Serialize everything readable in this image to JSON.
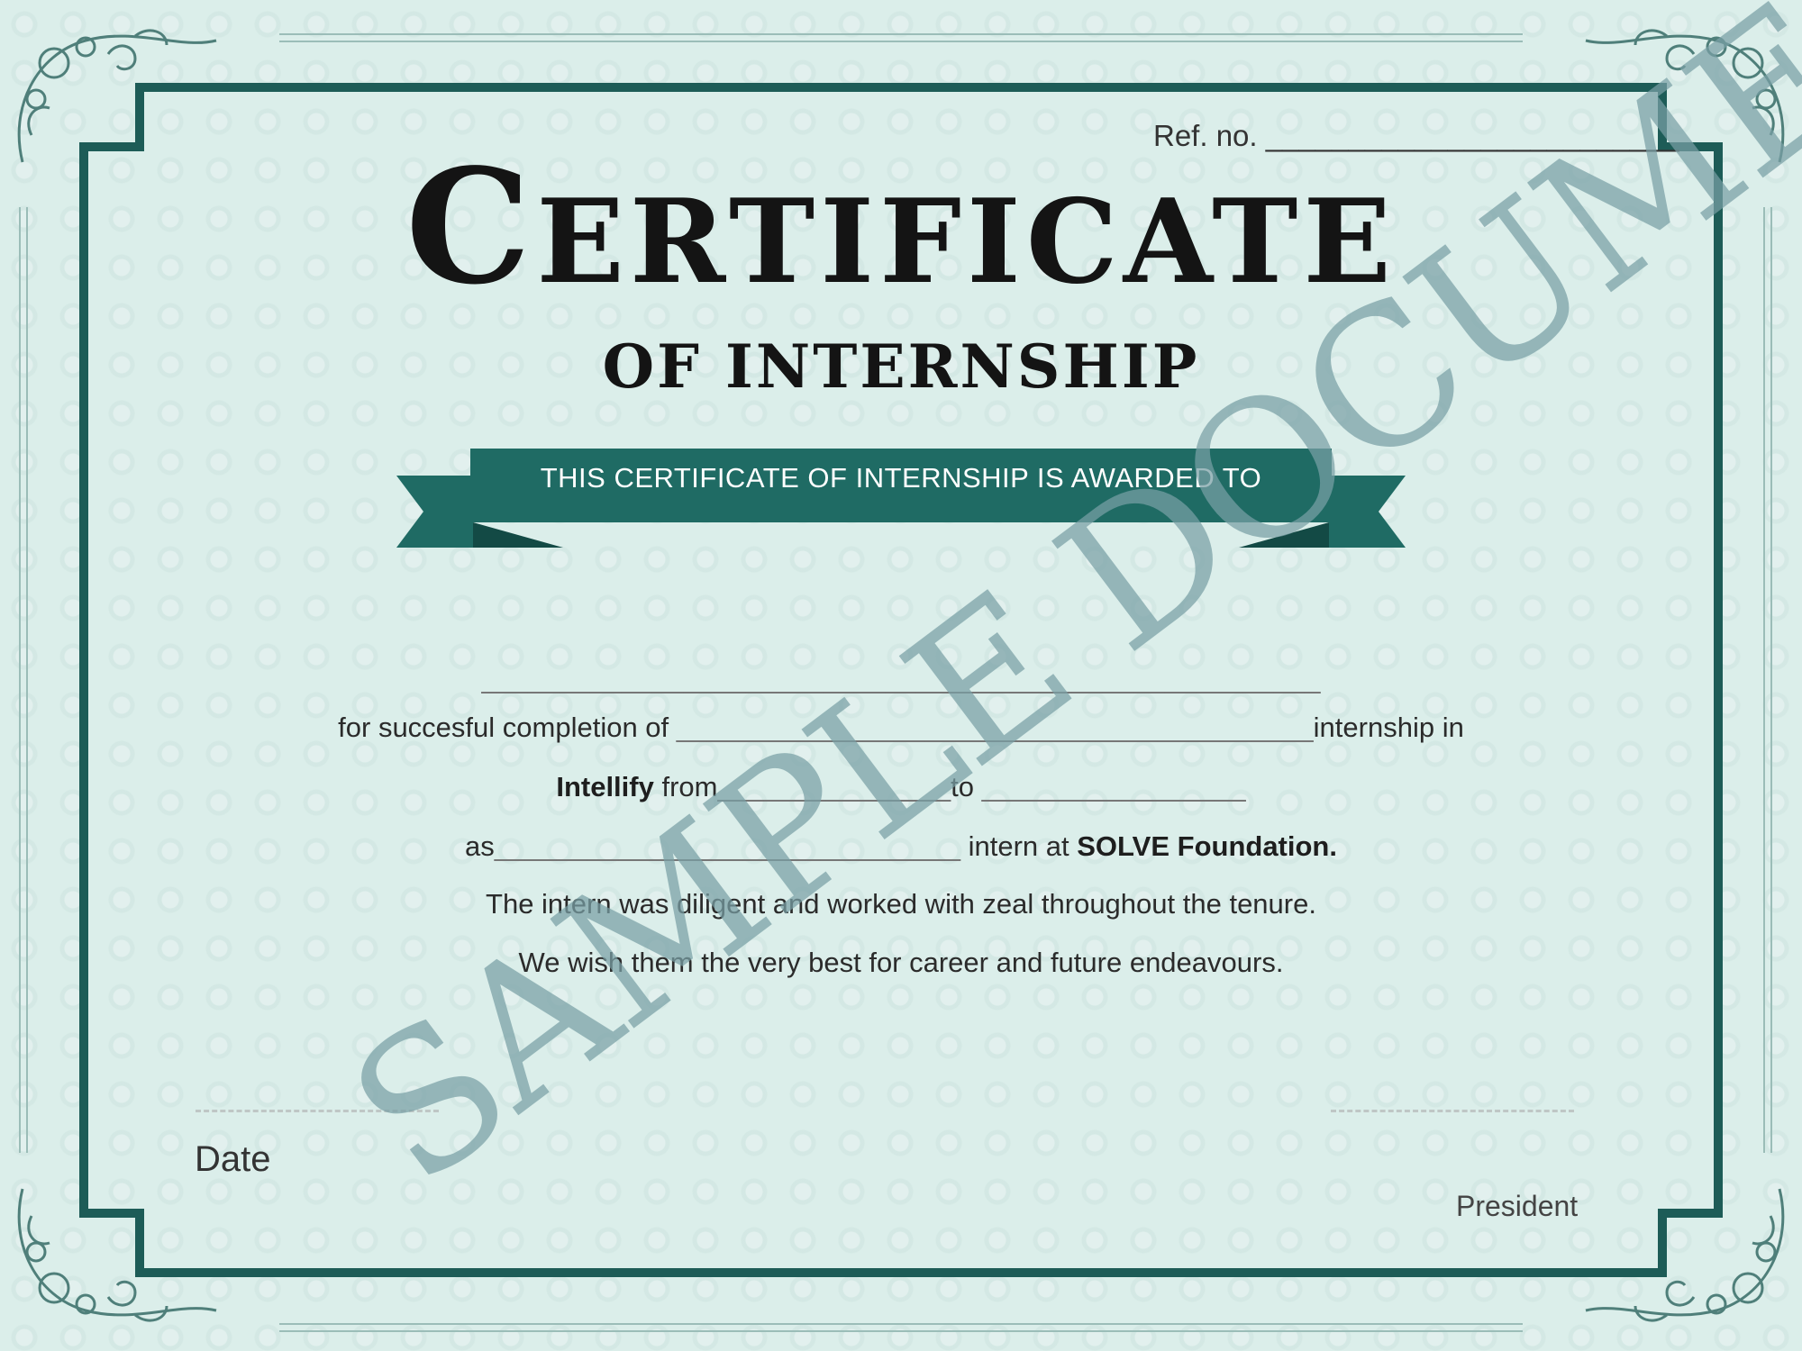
{
  "certificate": {
    "ref_label": "Ref. no.",
    "ref_blank": "_________________________",
    "title_first_letter": "C",
    "title_rest": "ERTIFICATE",
    "subtitle": "OF INTERNSHIP",
    "ribbon_text": "THIS CERTIFICATE OF INTERNSHIP IS AWARDED TO",
    "name_blank": "______________________________________________________",
    "line1_prefix": "for succesful completion of",
    "line1_blank": "_________________________________________",
    "line1_suffix": "internship in",
    "line2_org": "Intellify",
    "line2_from": "from",
    "line2_blank1": "_______________",
    "line2_to": "to",
    "line2_blank2": "_________________",
    "line3_prefix": "as",
    "line3_blank": "______________________________",
    "line3_middle": "intern at",
    "line3_org": "SOLVE Foundation.",
    "line4": "The intern was diligent and worked with zeal throughout the tenure.",
    "line5": "We wish them the very best for career and future endeavours.",
    "date_label": "Date",
    "president_label": "President",
    "watermark": "SAMPLE DOCUMENT"
  },
  "colors": {
    "background": "#dbeeea",
    "frame": "#1d5c57",
    "ribbon": "#1f6b64",
    "ribbon_dark": "#134a45",
    "watermark": "#7aa0a5"
  },
  "icons": [
    "corner-flourish-icon"
  ]
}
